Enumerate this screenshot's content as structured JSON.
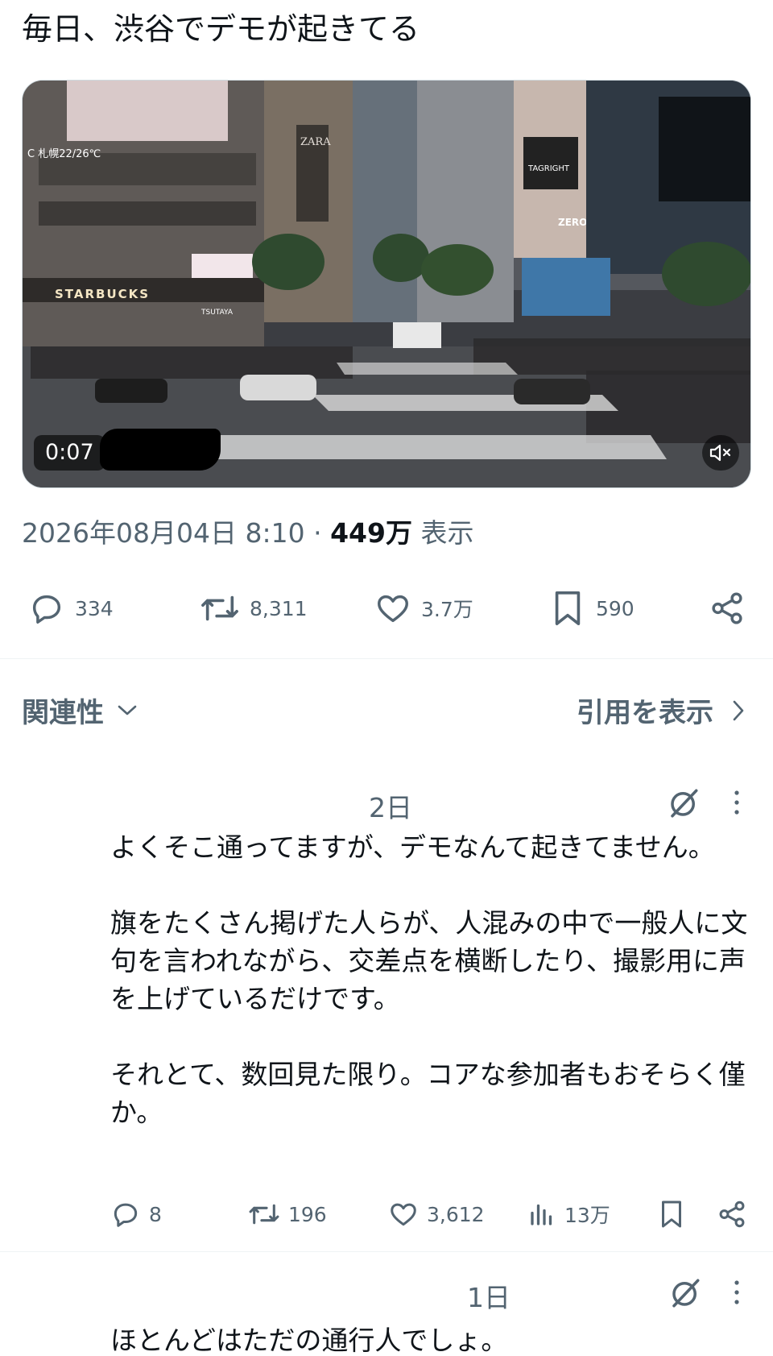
{
  "post": {
    "text": "毎日、渋谷でデモが起きてる",
    "video": {
      "duration": "0:07",
      "billboard_text": "C 札幌22/26℃",
      "storefront_sign": "STARBUCKS",
      "store_sign": "TSUTAYA",
      "building_sign": "ZARA",
      "ad_sign": "TAGRIGHT",
      "ad_sign_2": "ZERO"
    },
    "timestamp": "2026年08月04日 8:10",
    "separator": "·",
    "views_count": "449万",
    "views_label": "表示",
    "actions": {
      "replies": "334",
      "reposts": "8,311",
      "likes": "3.7万",
      "bookmarks": "590"
    }
  },
  "sort": {
    "label": "関連性"
  },
  "quotes": {
    "label": "引用を表示"
  },
  "replies": [
    {
      "time": "2日",
      "text": "よくそこ通ってますが、デモなんて起きてません。\n\n旗をたくさん掲げた人らが、人混みの中で一般人に文句を言われながら、交差点を横断したり、撮影用に声を上げているだけです。\n\nそれとて、数回見た限り。コアな参加者もおそらく僅か。",
      "actions": {
        "replies": "8",
        "reposts": "196",
        "likes": "3,612",
        "views": "13万"
      }
    },
    {
      "time": "1日",
      "text": "ほとんどはただの通行人でしょ。"
    }
  ],
  "colors": {
    "text_primary": "#0f1419",
    "text_secondary": "#536471",
    "divider": "#eff3f4"
  }
}
